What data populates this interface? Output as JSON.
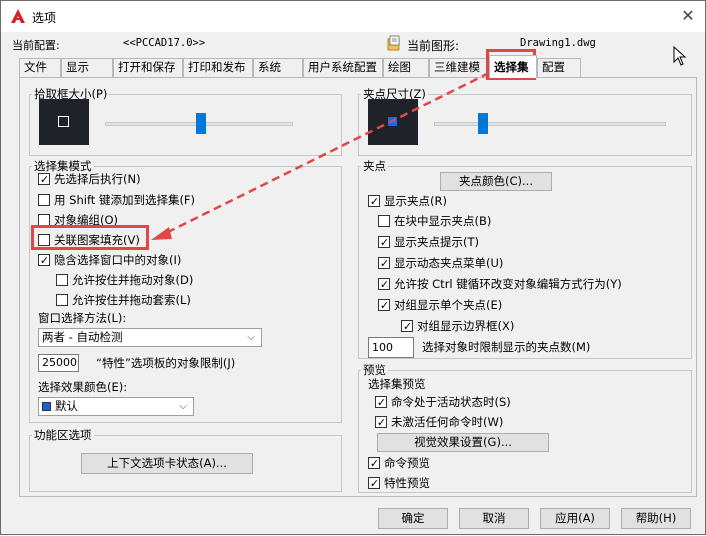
{
  "window": {
    "title": "选项",
    "current_profile_label": "当前配置:",
    "current_profile_value": "<<PCCAD17.0>>",
    "current_drawing_label": "当前图形:",
    "current_drawing_value": "Drawing1.dwg"
  },
  "tabs": [
    {
      "label": "文件"
    },
    {
      "label": "显示"
    },
    {
      "label": "打开和保存"
    },
    {
      "label": "打印和发布"
    },
    {
      "label": "系统"
    },
    {
      "label": "用户系统配置"
    },
    {
      "label": "绘图"
    },
    {
      "label": "三维建模"
    },
    {
      "label": "选择集"
    },
    {
      "label": "配置"
    }
  ],
  "pickbox": {
    "title": "拾取框大小(P)",
    "slider_level": 0.51
  },
  "grip_size": {
    "title": "夹点尺寸(Z)",
    "slider_level": 0.21
  },
  "selection_modes": {
    "title": "选择集模式",
    "noun_verb": "先选择后执行(N)",
    "shift_add": "用 Shift 键添加到选择集(F)",
    "object_group": "对象编组(O)",
    "associative_hatch": "关联图案填充(V)",
    "implied_window": "隐含选择窗口中的对象(I)",
    "press_drag_object": "允许按住并拖动对象(D)",
    "press_drag_lasso": "允许按住并拖动套索(L)",
    "window_method_label": "窗口选择方法(L):",
    "window_method_value": "两者 - 自动检测",
    "properties_limit_value": "25000",
    "properties_limit_label": "“特性”选项板的对象限制(J)",
    "effect_color_label": "选择效果颜色(E):",
    "effect_color_value": "默认"
  },
  "ribbon": {
    "title": "功能区选项",
    "contextual_tab_button": "上下文选项卡状态(A)..."
  },
  "grips": {
    "title": "夹点",
    "grip_colors_button": "夹点颜色(C)...",
    "show_grips": "显示夹点(R)",
    "grips_in_blocks": "在块中显示夹点(B)",
    "grip_tips": "显示夹点提示(T)",
    "dynamic_menu": "显示动态夹点菜单(U)",
    "ctrl_cycling": "允许按 Ctrl 键循环改变对象编辑方式行为(Y)",
    "single_grip_groups": "对组显示单个夹点(E)",
    "bbox_groups": "对组显示边界框(X)",
    "grip_limit_value": "100",
    "grip_limit_label": "选择对象时限制显示的夹点数(M)"
  },
  "preview": {
    "title": "预览",
    "selection_preview_label": "选择集预览",
    "command_active": "命令处于活动状态时(S)",
    "no_command": "未激活任何命令时(W)",
    "visual_effects_button": "视觉效果设置(G)...",
    "command_preview": "命令预览",
    "property_preview": "特性预览"
  },
  "buttons": {
    "ok": "确定",
    "cancel": "取消",
    "apply": "应用(A)",
    "help": "帮助(H)"
  },
  "colors": {
    "accent": "#0078d7",
    "annotation_red": "#e04848",
    "effect_swatch": "#1a5fd6"
  }
}
